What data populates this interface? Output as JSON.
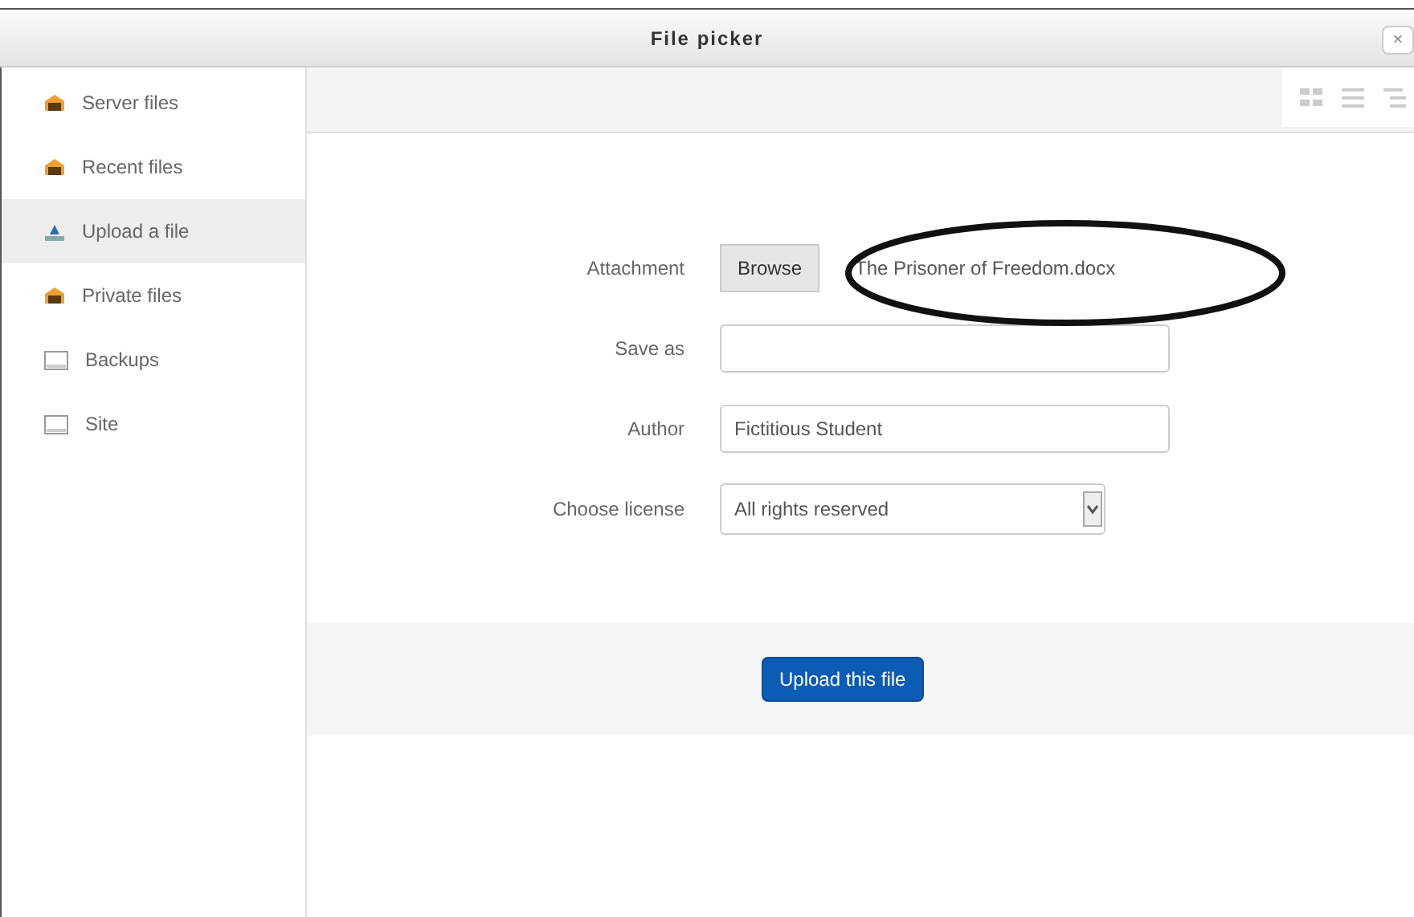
{
  "window": {
    "title": "File picker",
    "close": "×"
  },
  "sidebar": {
    "items": [
      {
        "label": "Server files",
        "kind": "repository",
        "selected": false
      },
      {
        "label": "Recent files",
        "kind": "repository",
        "selected": false
      },
      {
        "label": "Upload a file",
        "kind": "upload",
        "selected": true
      },
      {
        "label": "Private files",
        "kind": "repository",
        "selected": false
      },
      {
        "label": "Backups",
        "kind": "box",
        "selected": false
      },
      {
        "label": "Site",
        "kind": "box",
        "selected": false
      }
    ]
  },
  "toolbar": {
    "views": [
      {
        "kind": "icons",
        "selected": false
      },
      {
        "kind": "list",
        "selected": false
      },
      {
        "kind": "tree",
        "selected": false
      }
    ]
  },
  "form": {
    "fields": [
      {
        "label": "Attachment",
        "kind": "file",
        "button": "Browse",
        "value": "The Prisoner of Freedom.docx"
      },
      {
        "label": "Save as",
        "kind": "text"
      },
      {
        "label": "Author",
        "kind": "text",
        "value": "Fictitious Student"
      },
      {
        "label": "Choose license",
        "kind": "select",
        "value": "All rights reserved"
      }
    ]
  },
  "upload_button": "Upload this file"
}
